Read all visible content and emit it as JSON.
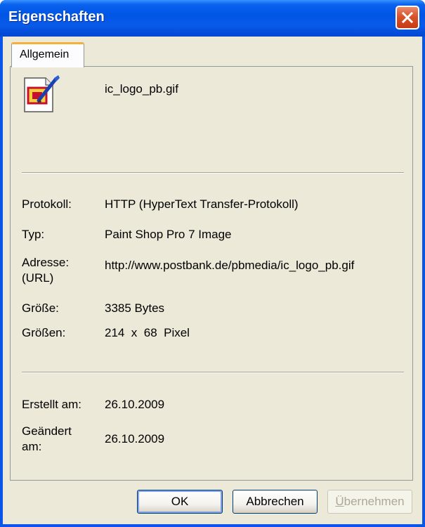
{
  "window": {
    "title": "Eigenschaften"
  },
  "tabs": [
    {
      "label": "Allgemein",
      "active": true
    }
  ],
  "file": {
    "name": "ic_logo_pb.gif",
    "icon": "paint-shop-pro-image-icon"
  },
  "properties": {
    "protocol": {
      "label": "Protokoll:",
      "value": "HTTP (HyperText Transfer-Protokoll)"
    },
    "type": {
      "label": "Typ:",
      "value": "Paint Shop Pro 7 Image"
    },
    "address": {
      "label_line1": "Adresse:",
      "label_line2": "(URL)",
      "value": "http://www.postbank.de/pbmedia/ic_logo_pb.gif"
    },
    "size": {
      "label": "Größe:",
      "value": "3385 Bytes"
    },
    "dimensions": {
      "label": "Größen:",
      "value": "214  x  68  Pixel"
    }
  },
  "dates": {
    "created": {
      "label": "Erstellt am:",
      "value": "26.10.2009"
    },
    "modified": {
      "label_line1": "Geändert",
      "label_line2": "am:",
      "value": "26.10.2009"
    }
  },
  "buttons": {
    "ok": "OK",
    "cancel": "Abbrechen",
    "apply_mnemonic": "Ü",
    "apply_rest": "bernehmen"
  },
  "colors": {
    "titlebar": "#0055e5",
    "face": "#ece9d8",
    "close_button": "#d9532a",
    "tab_highlight": "#f5b03a"
  }
}
